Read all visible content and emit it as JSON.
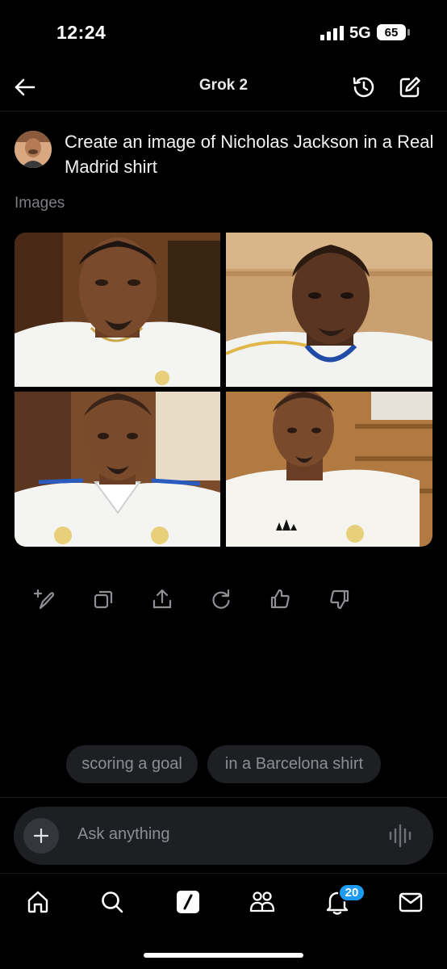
{
  "status_bar": {
    "time": "12:24",
    "network": "5G",
    "battery": "65"
  },
  "header": {
    "title": "Grok 2",
    "back_icon": "arrow-left-icon",
    "history_icon": "history-icon",
    "new_chat_icon": "compose-icon"
  },
  "conversation": {
    "prompt": "Create an image of Nicholas Jackson in a Real Madrid shirt",
    "section_label": "Images",
    "images": [
      {
        "name": "generated-image-1",
        "subject": "man in white Real Madrid shirt, indoor wood background"
      },
      {
        "name": "generated-image-2",
        "subject": "man in white shirt with blue collar, light wood background"
      },
      {
        "name": "generated-image-3",
        "subject": "man in white polo Real Madrid shirt, room background"
      },
      {
        "name": "generated-image-4",
        "subject": "man in white adidas Real Madrid shirt, wood cabin background"
      }
    ]
  },
  "actions": [
    "edit-image-icon",
    "copy-icon",
    "share-icon",
    "regenerate-icon",
    "thumbs-up-icon",
    "thumbs-down-icon"
  ],
  "suggestions": [
    "scoring a goal",
    "in a Barcelona shirt"
  ],
  "input": {
    "placeholder": "Ask anything"
  },
  "tab_bar": {
    "items": [
      "home-icon",
      "search-icon",
      "grok-icon",
      "communities-icon",
      "notifications-icon",
      "messages-icon"
    ],
    "notification_count": "20"
  },
  "colors": {
    "background": "#000000",
    "chip": "#1d1f23",
    "badge": "#1d9bf0",
    "muted_text": "#8b8e95"
  }
}
